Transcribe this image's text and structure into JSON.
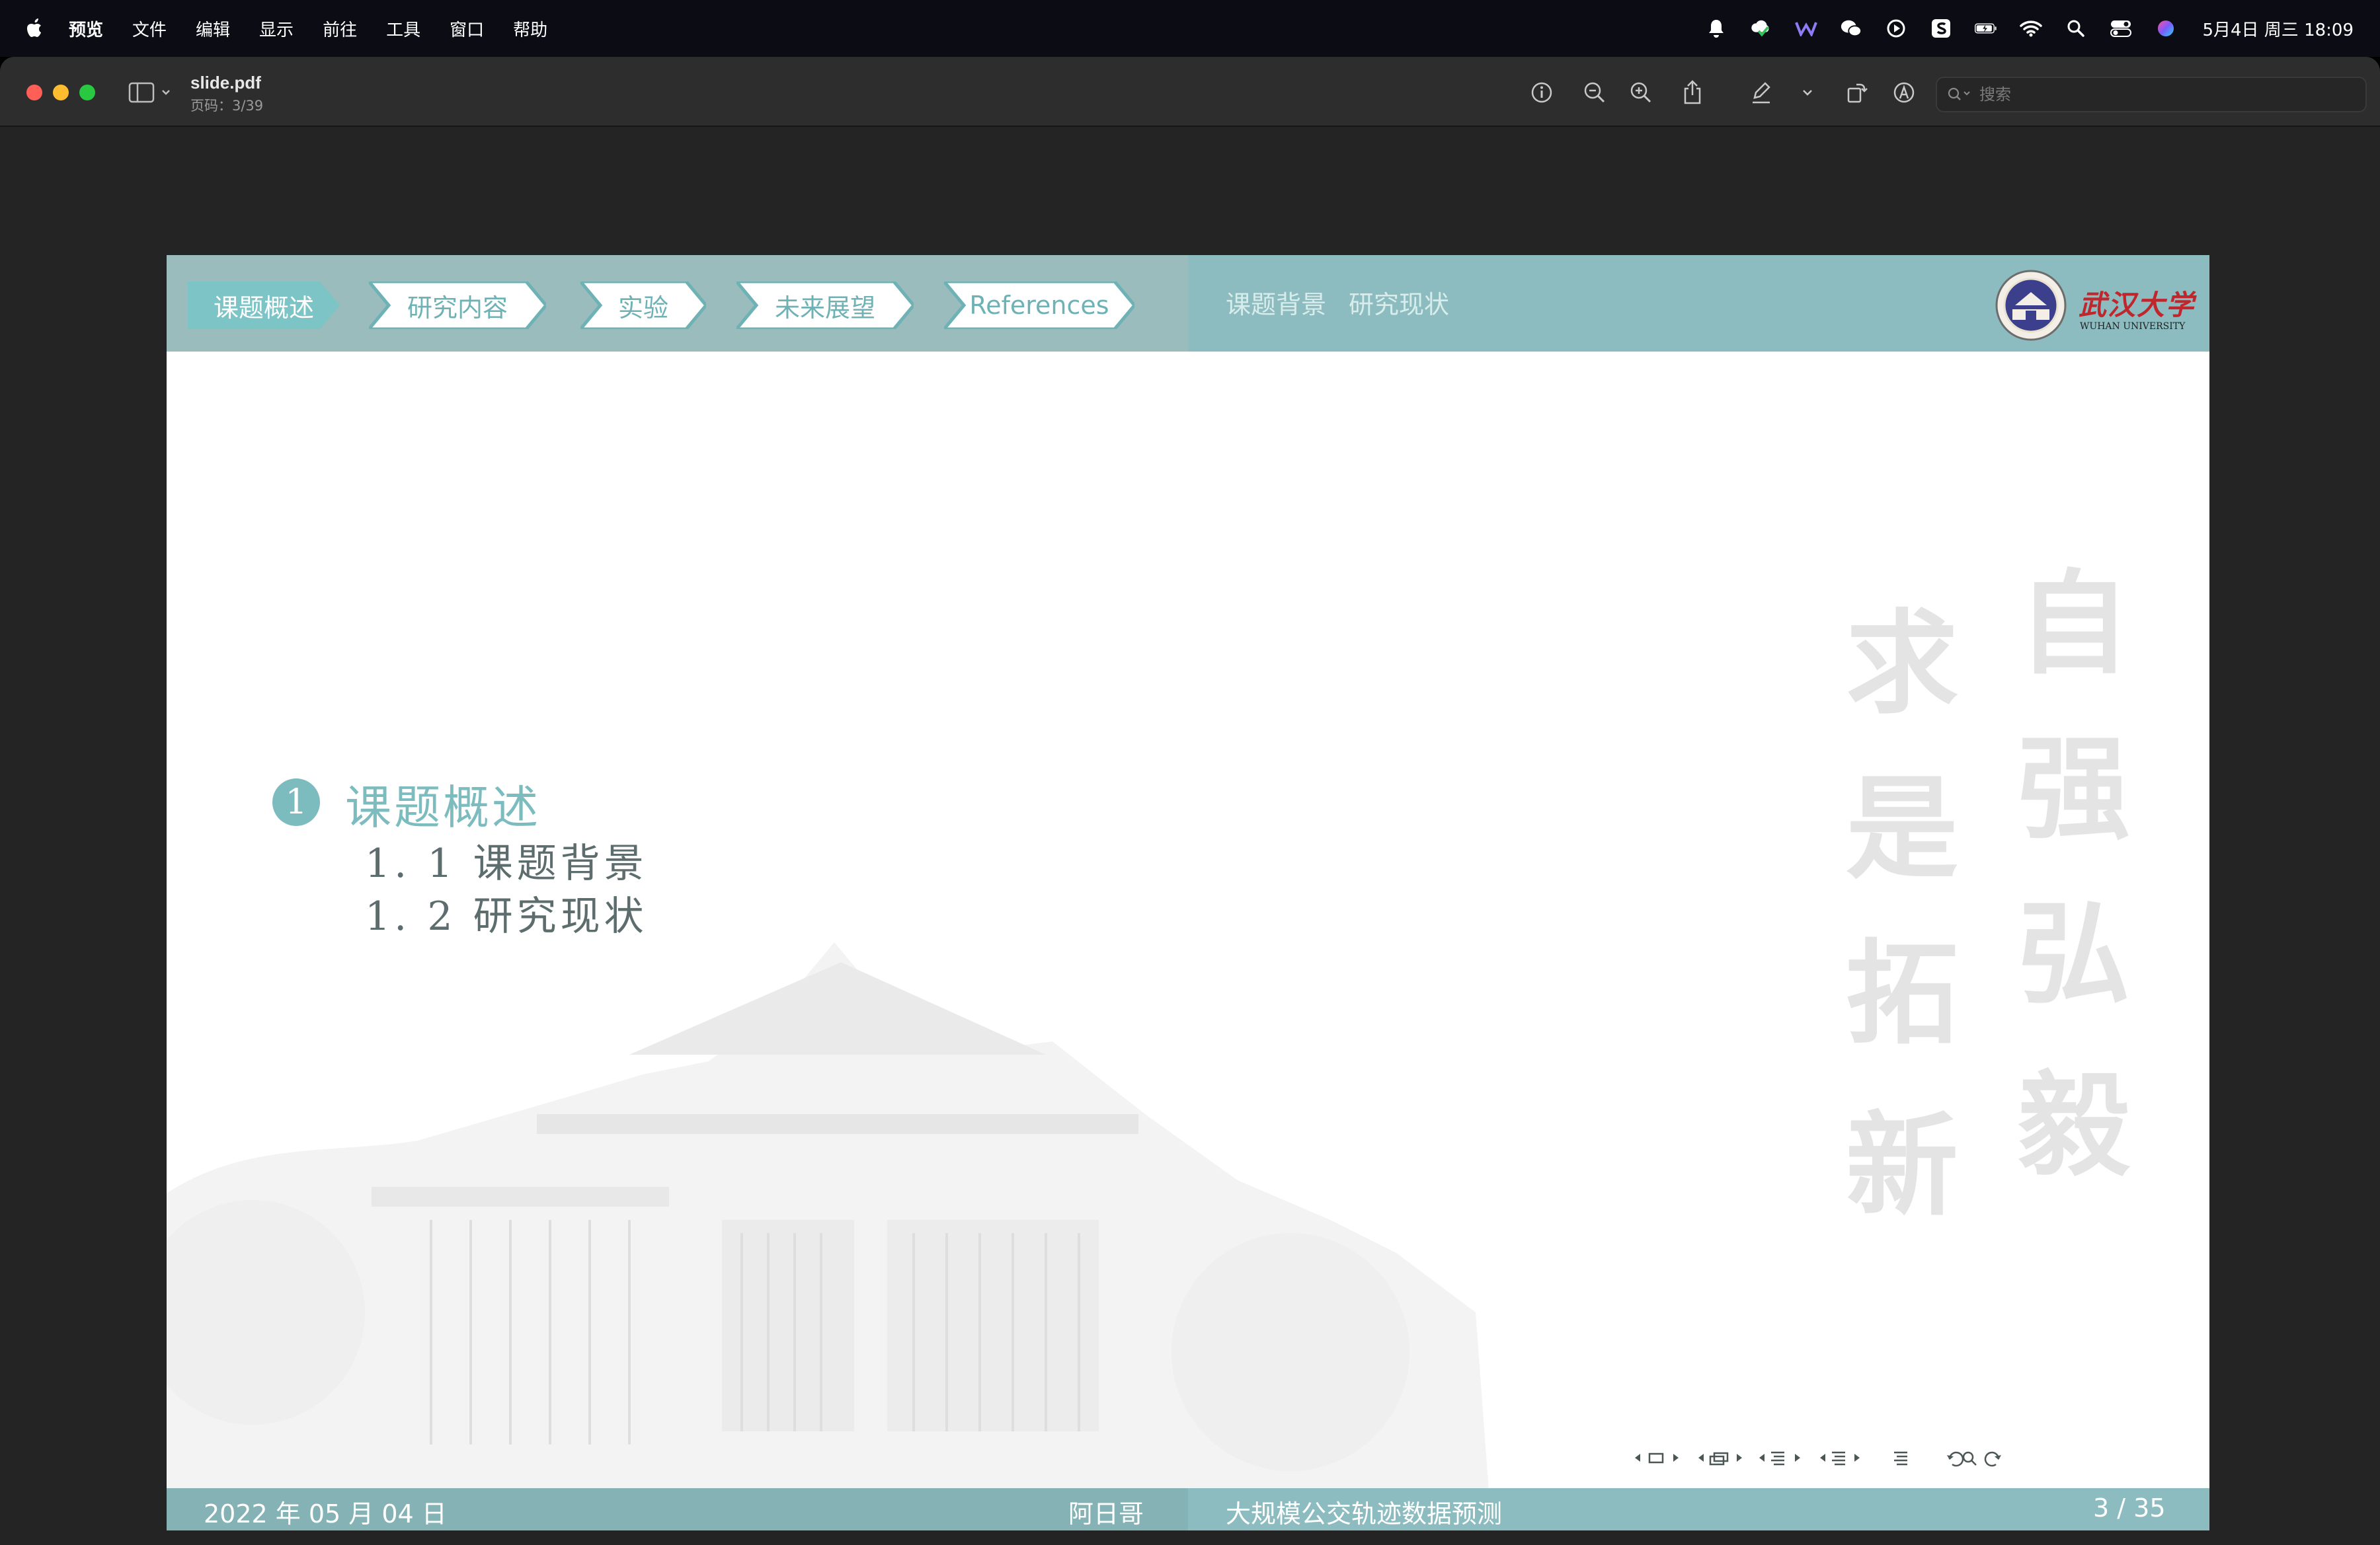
{
  "menubar": {
    "app_name": "预览",
    "items": [
      "文件",
      "编辑",
      "显示",
      "前往",
      "工具",
      "窗口",
      "帮助"
    ],
    "clock": "5月4日 周三 18:09",
    "status_icons": [
      "bell-icon",
      "cloud-check-icon",
      "w-app-icon",
      "wechat-icon",
      "play-icon",
      "s-app-icon",
      "battery-icon",
      "wifi-icon",
      "spotlight-search-icon",
      "control-center-icon",
      "siri-icon"
    ]
  },
  "window": {
    "title": "slide.pdf",
    "subtitle": "页码：3/39",
    "search": {
      "placeholder": "搜索",
      "value": ""
    },
    "toolbar_icons": [
      "info-icon",
      "zoom-out-icon",
      "zoom-in-icon",
      "share-icon",
      "markup-pen-icon",
      "chevron-down-icon",
      "rotate-icon",
      "annotate-icon"
    ]
  },
  "slide": {
    "nav_sections": [
      "课题概述",
      "研究内容",
      "实验",
      "未来展望",
      "References"
    ],
    "active_section": "课题概述",
    "subsections": [
      "课题背景",
      "研究现状"
    ],
    "logo_text": "武汉大学",
    "logo_subtext": "WUHAN UNIVERSITY",
    "toc": {
      "number": "1",
      "title": "课题概述",
      "items": [
        "1. 1 课题背景",
        "1. 2 研究现状"
      ]
    },
    "watermark_text": [
      "自",
      "强",
      "弘",
      "毅",
      "求",
      "是",
      "拓",
      "新"
    ],
    "footer": {
      "date": "2022 年 05 月 04 日",
      "author": "阿日哥",
      "title": "大规模公交轨迹数据预测",
      "page": "3 /  35"
    },
    "colors": {
      "accent": "#7cbcbf",
      "header": "#8cbcbf",
      "text": "#5d6d6d"
    }
  }
}
